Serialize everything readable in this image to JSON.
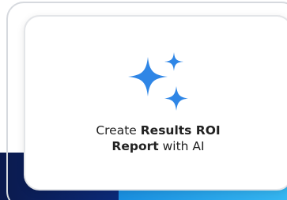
{
  "card": {
    "icon": "sparkles-icon",
    "accent_color": "#2f86e6",
    "caption": {
      "line1_prefix": "Create ",
      "line1_bold": "Results ROI",
      "line2_bold": "Report",
      "line2_suffix": " with AI"
    }
  },
  "background": {
    "band_colors": [
      "#0b1a4d",
      "#0f3fb0",
      "#35b7f2"
    ]
  }
}
